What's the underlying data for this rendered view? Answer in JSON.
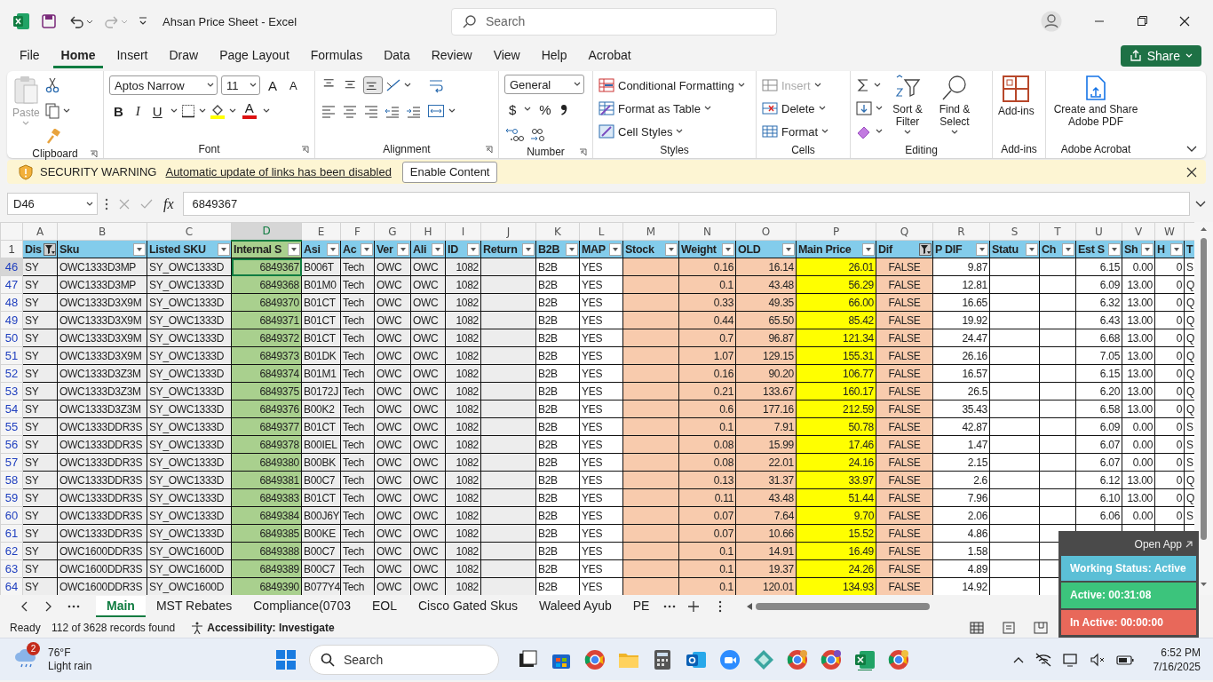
{
  "title_bar": {
    "title": "Ahsan Price Sheet  -  Excel",
    "search_placeholder": "Search"
  },
  "menu": {
    "tabs": [
      {
        "label": "File",
        "selected": false
      },
      {
        "label": "Home",
        "selected": true
      },
      {
        "label": "Insert",
        "selected": false
      },
      {
        "label": "Draw",
        "selected": false
      },
      {
        "label": "Page Layout",
        "selected": false
      },
      {
        "label": "Formulas",
        "selected": false
      },
      {
        "label": "Data",
        "selected": false
      },
      {
        "label": "Review",
        "selected": false
      },
      {
        "label": "View",
        "selected": false
      },
      {
        "label": "Help",
        "selected": false
      },
      {
        "label": "Acrobat",
        "selected": false
      }
    ],
    "share": "Share"
  },
  "ribbon": {
    "clipboard": {
      "label": "Clipboard",
      "paste": "Paste"
    },
    "font": {
      "label": "Font",
      "font_name": "Aptos Narrow",
      "font_size": "11",
      "grow": "A",
      "shrink": "A",
      "bold": "B",
      "italic": "I",
      "underline": "U",
      "font_color": "A"
    },
    "alignment": {
      "label": "Alignment",
      "vertical": [
        {
          "selected": false
        },
        {
          "selected": false
        },
        {
          "selected": true
        }
      ]
    },
    "number": {
      "label": "Number",
      "format": "General",
      "currency": "$",
      "percent": "%"
    },
    "styles": {
      "label": "Styles",
      "buttons": [
        {
          "label": "Conditional Formatting"
        },
        {
          "label": "Format as Table"
        },
        {
          "label": "Cell Styles"
        }
      ]
    },
    "cells": {
      "label": "Cells",
      "buttons": [
        {
          "label": "Insert",
          "disabled": true
        },
        {
          "label": "Delete",
          "disabled": false
        },
        {
          "label": "Format",
          "disabled": false
        }
      ]
    },
    "editing": {
      "label": "Editing",
      "sort": "Sort & Filter",
      "find": "Find & Select"
    },
    "addins": {
      "label": "Add-ins",
      "button": "Add-ins"
    },
    "acrobat": {
      "label": "Adobe Acrobat",
      "button": "Create and Share Adobe PDF"
    }
  },
  "security_bar": {
    "title": "SECURITY WARNING",
    "message": "Automatic update of links has been disabled",
    "button": "Enable Content"
  },
  "formula_bar": {
    "name_box": "D46",
    "insert_function": "fx",
    "value": "6849367"
  },
  "sheet": {
    "columns": [
      {
        "letter": "A",
        "header": "Dis",
        "kind": "text",
        "color": "#ededed",
        "filtered": true,
        "selected": false
      },
      {
        "letter": "B",
        "header": "Sku",
        "kind": "text",
        "color": "#ededed",
        "filtered": false,
        "selected": false
      },
      {
        "letter": "C",
        "header": "Listed SKU",
        "kind": "text",
        "color": "#ededed",
        "filtered": false,
        "selected": false
      },
      {
        "letter": "D",
        "header": "Internal S",
        "kind": "number",
        "color": "#a9d08e",
        "filtered": false,
        "selected": true
      },
      {
        "letter": "E",
        "header": "Asi",
        "kind": "text",
        "color": "#ededed",
        "filtered": false,
        "selected": false
      },
      {
        "letter": "F",
        "header": "Ac",
        "kind": "text",
        "color": "#ededed",
        "filtered": false,
        "selected": false
      },
      {
        "letter": "G",
        "header": "Ver",
        "kind": "text",
        "color": "#ededed",
        "filtered": false,
        "selected": false
      },
      {
        "letter": "H",
        "header": "Ali",
        "kind": "text",
        "color": "#ededed",
        "filtered": false,
        "selected": false
      },
      {
        "letter": "I",
        "header": "ID",
        "kind": "number",
        "color": "#ededed",
        "filtered": false,
        "selected": false
      },
      {
        "letter": "J",
        "header": "Return",
        "kind": "text",
        "color": "#ededed",
        "filtered": false,
        "selected": false
      },
      {
        "letter": "K",
        "header": "B2B",
        "kind": "text",
        "color": "#ffffff",
        "filtered": false,
        "selected": false
      },
      {
        "letter": "L",
        "header": "MAP",
        "kind": "text",
        "color": "#ffffff",
        "filtered": false,
        "selected": false
      },
      {
        "letter": "M",
        "header": "Stock",
        "kind": "text",
        "color": "#f8cbad",
        "filtered": false,
        "selected": false
      },
      {
        "letter": "N",
        "header": "Weight",
        "kind": "number",
        "color": "#f8cbad",
        "filtered": false,
        "selected": false
      },
      {
        "letter": "O",
        "header": "OLD",
        "kind": "number",
        "color": "#f8cbad",
        "filtered": false,
        "selected": false
      },
      {
        "letter": "P",
        "header": "Main Price",
        "kind": "number",
        "color": "#ffff00",
        "filtered": false,
        "selected": false
      },
      {
        "letter": "Q",
        "header": "Dif",
        "kind": "center",
        "color": "#f8cbad",
        "filtered": true,
        "selected": false
      },
      {
        "letter": "R",
        "header": "P DIF",
        "kind": "number",
        "color": "#ffffff",
        "filtered": false,
        "selected": false
      },
      {
        "letter": "S",
        "header": "Statu",
        "kind": "text",
        "color": "#ffffff",
        "filtered": false,
        "selected": false
      },
      {
        "letter": "T",
        "header": "Ch",
        "kind": "text",
        "color": "#ffffff",
        "filtered": false,
        "selected": false
      },
      {
        "letter": "U",
        "header": "Est S",
        "kind": "number",
        "color": "#ffffff",
        "filtered": false,
        "selected": false
      },
      {
        "letter": "V",
        "header": "Sh",
        "kind": "number",
        "color": "#ffffff",
        "filtered": false,
        "selected": false
      },
      {
        "letter": "W",
        "header": "H",
        "kind": "number",
        "color": "#ffffff",
        "filtered": false,
        "selected": false
      },
      {
        "header": "T",
        "kind": "text",
        "color": "#ffffff"
      }
    ],
    "header_row": "1",
    "rows": [
      {
        "number": "46",
        "selected": true,
        "cells": [
          "SY",
          "OWC1333D3MP",
          "SY_OWC1333D",
          "6849367",
          "B006T",
          "Tech",
          "OWC",
          "OWC",
          "1082",
          null,
          "B2B",
          "YES",
          null,
          "0.16",
          "16.14",
          "26.01",
          "FALSE",
          "9.87",
          null,
          null,
          "6.15",
          "0.00",
          "0",
          "S"
        ]
      },
      {
        "number": "47",
        "selected": false,
        "cells": [
          "SY",
          "OWC1333D3MP",
          "SY_OWC1333D",
          "6849368",
          "B01M0",
          "Tech",
          "OWC",
          "OWC",
          "1082",
          null,
          "B2B",
          "YES",
          null,
          "0.1",
          "43.48",
          "56.29",
          "FALSE",
          "12.81",
          null,
          null,
          "6.09",
          "13.00",
          "0",
          "Q"
        ]
      },
      {
        "number": "48",
        "selected": false,
        "cells": [
          "SY",
          "OWC1333D3X9M",
          "SY_OWC1333D",
          "6849370",
          "B01CT",
          "Tech",
          "OWC",
          "OWC",
          "1082",
          null,
          "B2B",
          "YES",
          null,
          "0.33",
          "49.35",
          "66.00",
          "FALSE",
          "16.65",
          null,
          null,
          "6.32",
          "13.00",
          "0",
          "Q"
        ]
      },
      {
        "number": "49",
        "selected": false,
        "cells": [
          "SY",
          "OWC1333D3X9M",
          "SY_OWC1333D",
          "6849371",
          "B01CT",
          "Tech",
          "OWC",
          "OWC",
          "1082",
          null,
          "B2B",
          "YES",
          null,
          "0.44",
          "65.50",
          "85.42",
          "FALSE",
          "19.92",
          null,
          null,
          "6.43",
          "13.00",
          "0",
          "Q"
        ]
      },
      {
        "number": "50",
        "selected": false,
        "cells": [
          "SY",
          "OWC1333D3X9M",
          "SY_OWC1333D",
          "6849372",
          "B01CT",
          "Tech",
          "OWC",
          "OWC",
          "1082",
          null,
          "B2B",
          "YES",
          null,
          "0.7",
          "96.87",
          "121.34",
          "FALSE",
          "24.47",
          null,
          null,
          "6.68",
          "13.00",
          "0",
          "Q"
        ]
      },
      {
        "number": "51",
        "selected": false,
        "cells": [
          "SY",
          "OWC1333D3X9M",
          "SY_OWC1333D",
          "6849373",
          "B01DK",
          "Tech",
          "OWC",
          "OWC",
          "1082",
          null,
          "B2B",
          "YES",
          null,
          "1.07",
          "129.15",
          "155.31",
          "FALSE",
          "26.16",
          null,
          null,
          "7.05",
          "13.00",
          "0",
          "Q"
        ]
      },
      {
        "number": "52",
        "selected": false,
        "cells": [
          "SY",
          "OWC1333D3Z3M",
          "SY_OWC1333D",
          "6849374",
          "B01M1",
          "Tech",
          "OWC",
          "OWC",
          "1082",
          null,
          "B2B",
          "YES",
          null,
          "0.16",
          "90.20",
          "106.77",
          "FALSE",
          "16.57",
          null,
          null,
          "6.15",
          "13.00",
          "0",
          "Q"
        ]
      },
      {
        "number": "53",
        "selected": false,
        "cells": [
          "SY",
          "OWC1333D3Z3M",
          "SY_OWC1333D",
          "6849375",
          "B0172J",
          "Tech",
          "OWC",
          "OWC",
          "1082",
          null,
          "B2B",
          "YES",
          null,
          "0.21",
          "133.67",
          "160.17",
          "FALSE",
          "26.5",
          null,
          null,
          "6.20",
          "13.00",
          "0",
          "Q"
        ]
      },
      {
        "number": "54",
        "selected": false,
        "cells": [
          "SY",
          "OWC1333D3Z3M",
          "SY_OWC1333D",
          "6849376",
          "B00K2",
          "Tech",
          "OWC",
          "OWC",
          "1082",
          null,
          "B2B",
          "YES",
          null,
          "0.6",
          "177.16",
          "212.59",
          "FALSE",
          "35.43",
          null,
          null,
          "6.58",
          "13.00",
          "0",
          "Q"
        ]
      },
      {
        "number": "55",
        "selected": false,
        "cells": [
          "SY",
          "OWC1333DDR3S",
          "SY_OWC1333D",
          "6849377",
          "B01CT",
          "Tech",
          "OWC",
          "OWC",
          "1082",
          null,
          "B2B",
          "YES",
          null,
          "0.1",
          "7.91",
          "50.78",
          "FALSE",
          "42.87",
          null,
          null,
          "6.09",
          "0.00",
          "0",
          "S"
        ]
      },
      {
        "number": "56",
        "selected": false,
        "cells": [
          "SY",
          "OWC1333DDR3S",
          "SY_OWC1333D",
          "6849378",
          "B00IEL",
          "Tech",
          "OWC",
          "OWC",
          "1082",
          null,
          "B2B",
          "YES",
          null,
          "0.08",
          "15.99",
          "17.46",
          "FALSE",
          "1.47",
          null,
          null,
          "6.07",
          "0.00",
          "0",
          "S"
        ]
      },
      {
        "number": "57",
        "selected": false,
        "cells": [
          "SY",
          "OWC1333DDR3S",
          "SY_OWC1333D",
          "6849380",
          "B00BK",
          "Tech",
          "OWC",
          "OWC",
          "1082",
          null,
          "B2B",
          "YES",
          null,
          "0.08",
          "22.01",
          "24.16",
          "FALSE",
          "2.15",
          null,
          null,
          "6.07",
          "0.00",
          "0",
          "S"
        ]
      },
      {
        "number": "58",
        "selected": false,
        "cells": [
          "SY",
          "OWC1333DDR3S",
          "SY_OWC1333D",
          "6849381",
          "B00C7",
          "Tech",
          "OWC",
          "OWC",
          "1082",
          null,
          "B2B",
          "YES",
          null,
          "0.13",
          "31.37",
          "33.97",
          "FALSE",
          "2.6",
          null,
          null,
          "6.12",
          "13.00",
          "0",
          "Q"
        ]
      },
      {
        "number": "59",
        "selected": false,
        "cells": [
          "SY",
          "OWC1333DDR3S",
          "SY_OWC1333D",
          "6849383",
          "B01CT",
          "Tech",
          "OWC",
          "OWC",
          "1082",
          null,
          "B2B",
          "YES",
          null,
          "0.11",
          "43.48",
          "51.44",
          "FALSE",
          "7.96",
          null,
          null,
          "6.10",
          "13.00",
          "0",
          "Q"
        ]
      },
      {
        "number": "60",
        "selected": false,
        "cells": [
          "SY",
          "OWC1333DDR3S",
          "SY_OWC1333D",
          "6849384",
          "B00J6Y",
          "Tech",
          "OWC",
          "OWC",
          "1082",
          null,
          "B2B",
          "YES",
          null,
          "0.07",
          "7.64",
          "9.70",
          "FALSE",
          "2.06",
          null,
          null,
          "6.06",
          "0.00",
          "0",
          "S"
        ]
      },
      {
        "number": "61",
        "selected": false,
        "cells": [
          "SY",
          "OWC1333DDR3S",
          "SY_OWC1333D",
          "6849385",
          "B00KE",
          "Tech",
          "OWC",
          "OWC",
          "1082",
          null,
          "B2B",
          "YES",
          null,
          "0.07",
          "10.66",
          "15.52",
          "FALSE",
          "4.86",
          null,
          null,
          null,
          null,
          null,
          null
        ]
      },
      {
        "number": "62",
        "selected": false,
        "cells": [
          "SY",
          "OWC1600DDR3S",
          "SY_OWC1600D",
          "6849388",
          "B00C7",
          "Tech",
          "OWC",
          "OWC",
          "1082",
          null,
          "B2B",
          "YES",
          null,
          "0.1",
          "14.91",
          "16.49",
          "FALSE",
          "1.58",
          null,
          null,
          null,
          null,
          null,
          null
        ]
      },
      {
        "number": "63",
        "selected": false,
        "cells": [
          "SY",
          "OWC1600DDR3S",
          "SY_OWC1600D",
          "6849389",
          "B00C7",
          "Tech",
          "OWC",
          "OWC",
          "1082",
          null,
          "B2B",
          "YES",
          null,
          "0.1",
          "19.37",
          "24.26",
          "FALSE",
          "4.89",
          null,
          null,
          null,
          null,
          null,
          null
        ]
      },
      {
        "number": "64",
        "selected": false,
        "cells": [
          "SY",
          "OWC1600DDR3S",
          "SY_OWC1600D",
          "6849390",
          "B077Y4",
          "Tech",
          "OWC",
          "OWC",
          "1082",
          null,
          "B2B",
          "YES",
          null,
          "0.1",
          "120.01",
          "134.93",
          "FALSE",
          "14.92",
          null,
          null,
          null,
          null,
          null,
          null
        ]
      }
    ]
  },
  "sheet_tabs": [
    {
      "label": "Main",
      "selected": true
    },
    {
      "label": "MST Rebates",
      "selected": false
    },
    {
      "label": "Compliance(0703",
      "selected": false
    },
    {
      "label": "EOL",
      "selected": false
    },
    {
      "label": "Cisco Gated Skus",
      "selected": false
    },
    {
      "label": "Waleed Ayub",
      "selected": false
    },
    {
      "label": "PE",
      "selected": false
    }
  ],
  "status_bar": {
    "mode": "Ready",
    "records": "112 of 3628 records found",
    "accessibility": "Accessibility: Investigate"
  },
  "tracker": {
    "open_app": "Open App",
    "statuses": [
      {
        "label": "Working Status: Active",
        "color": "#5bbfd6"
      },
      {
        "label": "Active: 00:31:08",
        "color": "#3cc47c"
      },
      {
        "label": "In Active: 00:00:00",
        "color": "#e8685a"
      }
    ]
  },
  "taskbar": {
    "weather_badge": "2",
    "temperature": "76°F",
    "condition": "Light rain",
    "search_placeholder": "Search",
    "time": "6:52 PM",
    "date": "7/16/2025"
  }
}
